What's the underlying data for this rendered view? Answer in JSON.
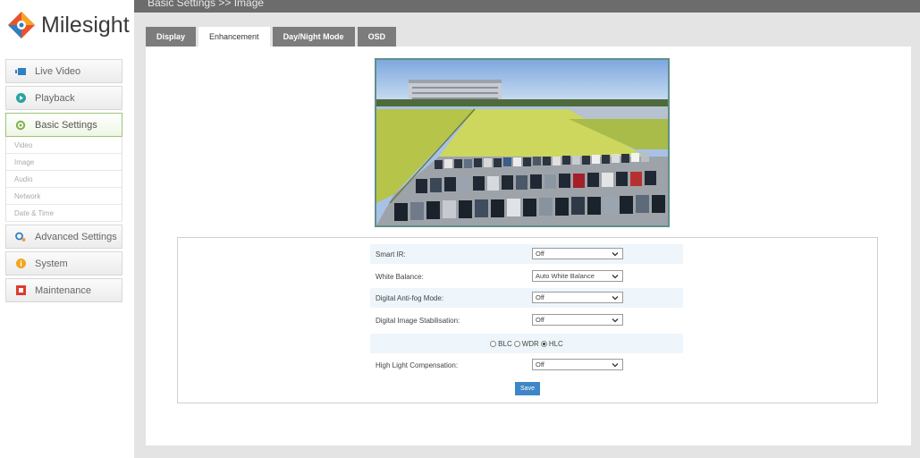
{
  "brand": {
    "name": "Milesight"
  },
  "breadcrumb": "Basic Settings >> Image",
  "sidebar": {
    "items": [
      {
        "label": "Live Video",
        "icon": "live-video-icon"
      },
      {
        "label": "Playback",
        "icon": "playback-icon"
      },
      {
        "label": "Basic Settings",
        "icon": "gear-icon"
      },
      {
        "label": "Advanced Settings",
        "icon": "advanced-gear-icon"
      },
      {
        "label": "System",
        "icon": "info-icon"
      },
      {
        "label": "Maintenance",
        "icon": "maintenance-icon"
      }
    ],
    "submenu": [
      "Video",
      "Image",
      "Audio",
      "Network",
      "Date & Time"
    ]
  },
  "tabs": [
    "Display",
    "Enhancement",
    "Day/Night Mode",
    "OSD"
  ],
  "active_tab": "Enhancement",
  "settings": {
    "smart_ir": {
      "label": "Smart IR:",
      "value": "Off"
    },
    "white_balance": {
      "label": "White Balance:",
      "value": "Auto White Balance"
    },
    "antifog": {
      "label": "Digital Anti-fog Mode:",
      "value": "Off"
    },
    "stabilisation": {
      "label": "Digital Image Stabilisation:",
      "value": "Off"
    },
    "mode_options": [
      "BLC",
      "WDR",
      "HLC"
    ],
    "mode_selected": "HLC",
    "hlc": {
      "label": "High Light Compensation:",
      "value": "Off"
    }
  },
  "save_label": "Save",
  "colors": {
    "accent": "#3f86c6",
    "active_border": "#9fc37a",
    "tab_bg": "#7c7c7c"
  }
}
